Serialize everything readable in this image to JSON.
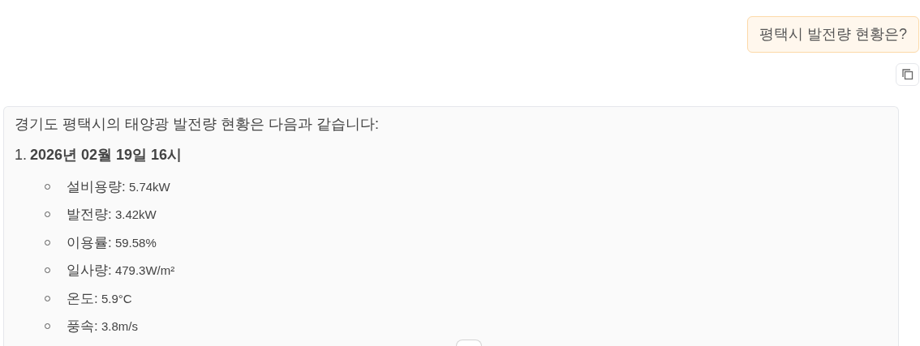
{
  "user_message": {
    "text": "평택시 발전량 현황은?"
  },
  "assistant_message": {
    "intro": "경기도 평택시의 태양광 발전량 현황은 다음과 같습니다:",
    "sections": [
      {
        "number": "1.",
        "heading": "2026년 02월 19일 16시",
        "items": [
          {
            "label": "설비용량:",
            "value": "5.74kW"
          },
          {
            "label": "발전량:",
            "value": "3.42kW"
          },
          {
            "label": "이용률:",
            "value": "59.58%"
          },
          {
            "label": "일사량:",
            "value": "479.3W/m²"
          },
          {
            "label": "온도:",
            "value": "5.9°C"
          },
          {
            "label": "풍속:",
            "value": "3.8m/s"
          }
        ]
      }
    ]
  }
}
